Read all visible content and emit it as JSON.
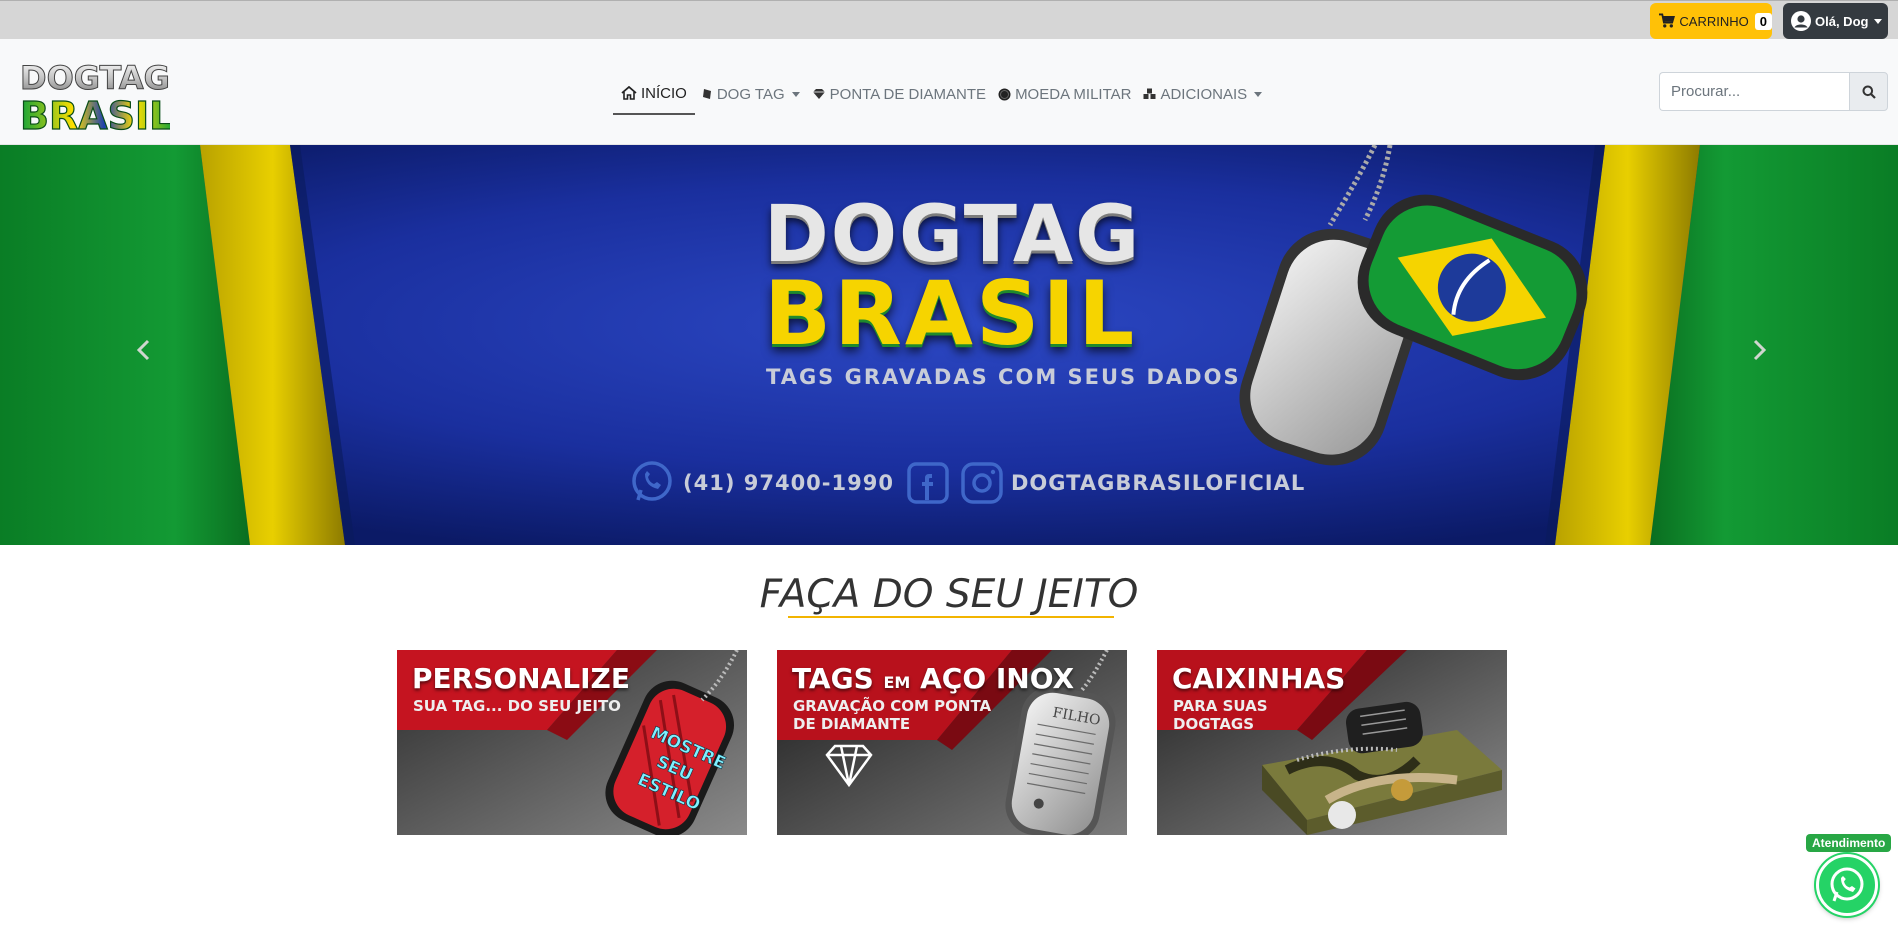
{
  "topbar": {
    "cart_label": "CARRINHO",
    "cart_count": "0",
    "user_label": "Olá, Dog"
  },
  "brand": {
    "logo_line1": "DOGTAG",
    "logo_line2": "BRASIL"
  },
  "nav": {
    "items": [
      {
        "label": "INÍCIO",
        "icon": "home-icon",
        "active": true
      },
      {
        "label": "DOG TAG",
        "icon": "dogtag-icon",
        "dropdown": true
      },
      {
        "label": "PONTA DE DIAMANTE",
        "icon": "diamond-icon"
      },
      {
        "label": "MOEDA MILITAR",
        "icon": "coin-icon"
      },
      {
        "label": "ADICIONAIS",
        "icon": "cubes-icon",
        "dropdown": true
      }
    ]
  },
  "search": {
    "placeholder": "Procurar..."
  },
  "hero": {
    "title_line1": "DOGTAG",
    "title_line2": "BRASIL",
    "tagline": "TAGS GRAVADAS COM SEUS DADOS",
    "phone": "(41) 97400-1990",
    "social_handle": "DOGTAGBRASILOFICIAL"
  },
  "section": {
    "title": "FAÇA DO SEU JEITO"
  },
  "cards": [
    {
      "title": "PERSONALIZE",
      "subtitle": "SUA TAG... DO SEU JEITO",
      "tag_text": "MOSTRE SEU ESTILO"
    },
    {
      "title_main": "TAGS",
      "title_small": "EM",
      "title_rest": "AÇO INOX",
      "subtitle": "GRAVAÇÃO COM PONTA\nDE DIAMANTE",
      "tag_text": "FILHO"
    },
    {
      "title": "CAIXINHAS",
      "subtitle": "PARA SUAS\nDOGTAGS"
    }
  ],
  "whatsapp": {
    "label": "Atendimento"
  },
  "colors": {
    "accent_yellow": "#ffc107",
    "dark": "#343a40",
    "whatsapp_green": "#25d366",
    "hero_blue": "#0f2a8c",
    "flag_green": "#0a8a2a"
  }
}
